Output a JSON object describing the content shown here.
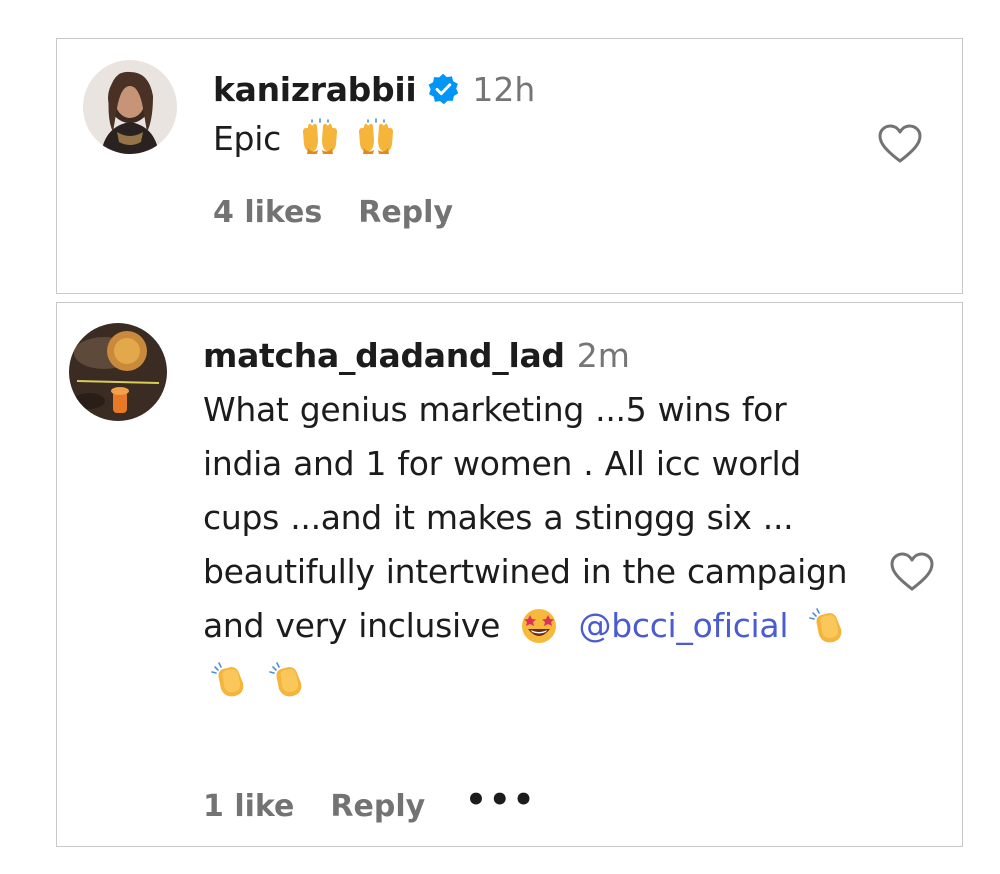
{
  "comments": [
    {
      "username": "kanizrabbii",
      "verified": true,
      "time": "12h",
      "text_before": "Epic",
      "emojis": [
        "raising-hands-emoji",
        "raising-hands-emoji"
      ],
      "likes": "4 likes",
      "reply": "Reply"
    },
    {
      "username": "matcha_dadand_lad",
      "verified": false,
      "time": "2m",
      "text": "What genius marketing ...5 wins for india and 1 for women . All icc world cups ...and it makes a stinggg six ... beautifully intertwined in the campaign and very inclusive",
      "mention": "@bcci_oficial",
      "emojis": [
        "star-struck-emoji",
        "clapping-hands-emoji",
        "clapping-hands-emoji",
        "clapping-hands-emoji"
      ],
      "likes": "1 like",
      "reply": "Reply",
      "more": "•••"
    }
  ],
  "colors": {
    "username": "#1c1c1c",
    "meta_gray": "#757575",
    "mention_blue": "#4a5cd0",
    "verified_blue": "#0095f6",
    "border": "#c9c9c9"
  }
}
